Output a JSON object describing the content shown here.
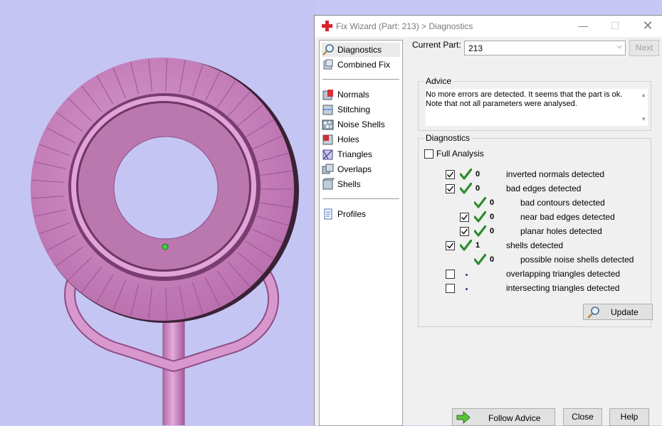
{
  "window": {
    "title": "Fix Wizard (Part: 213) > Diagnostics",
    "minimize_icon": "minimize-icon",
    "maximize_icon": "maximize-icon",
    "close_icon": "close-icon"
  },
  "sidebar": {
    "groups": [
      [
        {
          "label": "Diagnostics",
          "icon": "magnifier-icon",
          "selected": true
        },
        {
          "label": "Combined Fix",
          "icon": "cube-stack-icon",
          "selected": false
        }
      ],
      [
        {
          "label": "Normals",
          "icon": "normals-icon"
        },
        {
          "label": "Stitching",
          "icon": "stitching-icon"
        },
        {
          "label": "Noise Shells",
          "icon": "noise-shells-icon"
        },
        {
          "label": "Holes",
          "icon": "holes-icon"
        },
        {
          "label": "Triangles",
          "icon": "triangles-icon"
        },
        {
          "label": "Overlaps",
          "icon": "overlaps-icon"
        },
        {
          "label": "Shells",
          "icon": "shells-icon"
        }
      ],
      [
        {
          "label": "Profiles",
          "icon": "document-icon"
        }
      ]
    ]
  },
  "current_part": {
    "label": "Current Part:",
    "value": "213",
    "next_label": "Next"
  },
  "advice": {
    "title": "Advice",
    "text_line1": "No more errors are detected. It seems that the part is ok.",
    "text_line2": "Note that not all parameters were analysed."
  },
  "diagnostics": {
    "title": "Diagnostics",
    "full_analysis_label": "Full Analysis",
    "full_analysis_checked": false,
    "rows": [
      {
        "checkbox": true,
        "checked": true,
        "status": "ok",
        "count": "0",
        "label": "inverted normals detected",
        "indent": 0
      },
      {
        "checkbox": true,
        "checked": true,
        "status": "ok",
        "count": "0",
        "label": "bad edges detected",
        "indent": 0
      },
      {
        "checkbox": false,
        "checked": false,
        "status": "ok",
        "count": "0",
        "label": "bad contours detected",
        "indent": 1
      },
      {
        "checkbox": true,
        "checked": true,
        "status": "ok",
        "count": "0",
        "label": "near bad edges detected",
        "indent": 1
      },
      {
        "checkbox": true,
        "checked": true,
        "status": "ok",
        "count": "0",
        "label": "planar holes detected",
        "indent": 1
      },
      {
        "checkbox": true,
        "checked": true,
        "status": "ok",
        "count": "1",
        "label": "shells detected",
        "indent": 0
      },
      {
        "checkbox": false,
        "checked": false,
        "status": "ok",
        "count": "0",
        "label": "possible noise shells detected",
        "indent": 1
      },
      {
        "checkbox": true,
        "checked": false,
        "status": "dot",
        "count": "",
        "label": "overlapping triangles detected",
        "indent": 0
      },
      {
        "checkbox": true,
        "checked": false,
        "status": "dot",
        "count": "",
        "label": "intersecting triangles detected",
        "indent": 0
      }
    ],
    "update_label": "Update"
  },
  "footer": {
    "follow_advice_label": "Follow Advice",
    "close_label": "Close",
    "help_label": "Help"
  },
  "colors": {
    "viewport_bg": "#c5c5f4",
    "part_fill": "#c47fb8",
    "check_green": "#2e8b2e"
  }
}
